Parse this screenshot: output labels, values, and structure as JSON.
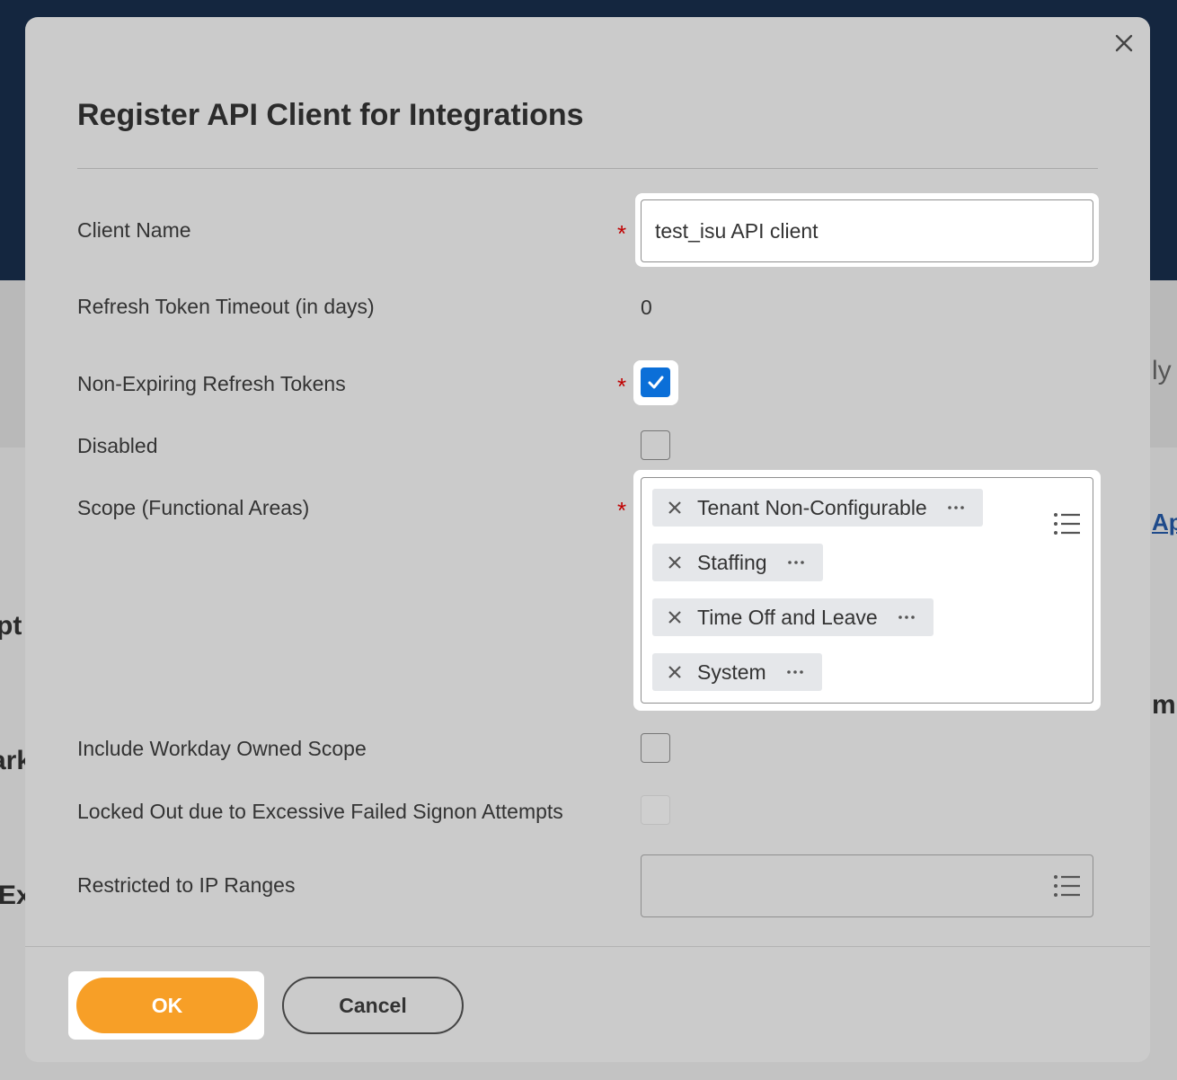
{
  "background": {
    "fragments": [
      "ly",
      "Ap",
      "pt",
      "m",
      "ark",
      "Ex"
    ]
  },
  "dialog": {
    "title": "Register API Client for Integrations",
    "close_icon": "close-icon",
    "fields": {
      "client_name": {
        "label": "Client Name",
        "value": "test_isu API client",
        "required": "*"
      },
      "refresh_timeout": {
        "label": "Refresh Token Timeout (in days)",
        "value": "0"
      },
      "non_expiring": {
        "label": "Non-Expiring Refresh Tokens",
        "checked": true,
        "required": "*"
      },
      "disabled": {
        "label": "Disabled",
        "checked": false
      },
      "scope": {
        "label": "Scope (Functional Areas)",
        "required": "*",
        "items": [
          "Tenant Non-Configurable",
          "Staffing",
          "Time Off and Leave",
          "System"
        ],
        "prompt_icon": "list-icon"
      },
      "include_workday": {
        "label": "Include Workday Owned Scope",
        "checked": false
      },
      "locked_out": {
        "label": "Locked Out due to Excessive Failed Signon Attempts",
        "checked": false
      },
      "ip_ranges": {
        "label": "Restricted to IP Ranges",
        "value": "",
        "prompt_icon": "list-icon"
      }
    },
    "buttons": {
      "ok": "OK",
      "cancel": "Cancel"
    }
  },
  "colors": {
    "accent": "#f79f27",
    "checkbox_checked": "#0b6fd8",
    "required": "#c00000",
    "highlight": "#ffffff"
  }
}
